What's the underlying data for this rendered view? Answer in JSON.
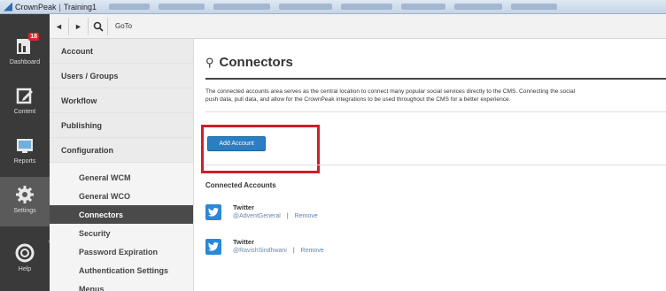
{
  "browser": {
    "tab_titles": [
      "CrownPeak",
      "Training1"
    ],
    "separator": "|"
  },
  "rail": {
    "items": [
      {
        "label": "Dashboard",
        "badge": "18",
        "icon": "dashboard-icon"
      },
      {
        "label": "Content",
        "icon": "edit-icon"
      },
      {
        "label": "Reports",
        "icon": "reports-icon"
      },
      {
        "label": "Settings",
        "icon": "gear-icon",
        "active": true
      },
      {
        "label": "Help",
        "icon": "lifebuoy-icon"
      }
    ]
  },
  "toolbar": {
    "back_icon": "◄",
    "forward_icon": "►",
    "goto_label": "GoTo"
  },
  "nav": {
    "groups": [
      "Account",
      "Users / Groups",
      "Workflow",
      "Publishing",
      "Configuration"
    ],
    "sub_items": [
      "General WCM",
      "General WCO",
      "Connectors",
      "Security",
      "Password Expiration",
      "Authentication Settings",
      "Menus"
    ],
    "active_sub": "Connectors"
  },
  "main": {
    "title": "Connectors",
    "description_line1": "The connected accounts area serves as the central location to connect many popular social services directly to the CMS. Connecting the social",
    "description_line2": "push data, pull data, and allow for the CrownPeak integrations to be used throughout the CMS for a better experience.",
    "add_button": "Add Account",
    "section_title": "Connected Accounts",
    "accounts": [
      {
        "service": "Twitter",
        "user": "@AdventGeneral",
        "separator": "|",
        "action": "Remove"
      },
      {
        "service": "Twitter",
        "user": "@RavishSindhwani",
        "separator": "|",
        "action": "Remove"
      }
    ]
  },
  "colors": {
    "rail_bg": "#3a3a3a",
    "accent_blue": "#2b7ec2",
    "highlight_red": "#cc1f2a",
    "twitter_blue": "#2b88d8"
  }
}
